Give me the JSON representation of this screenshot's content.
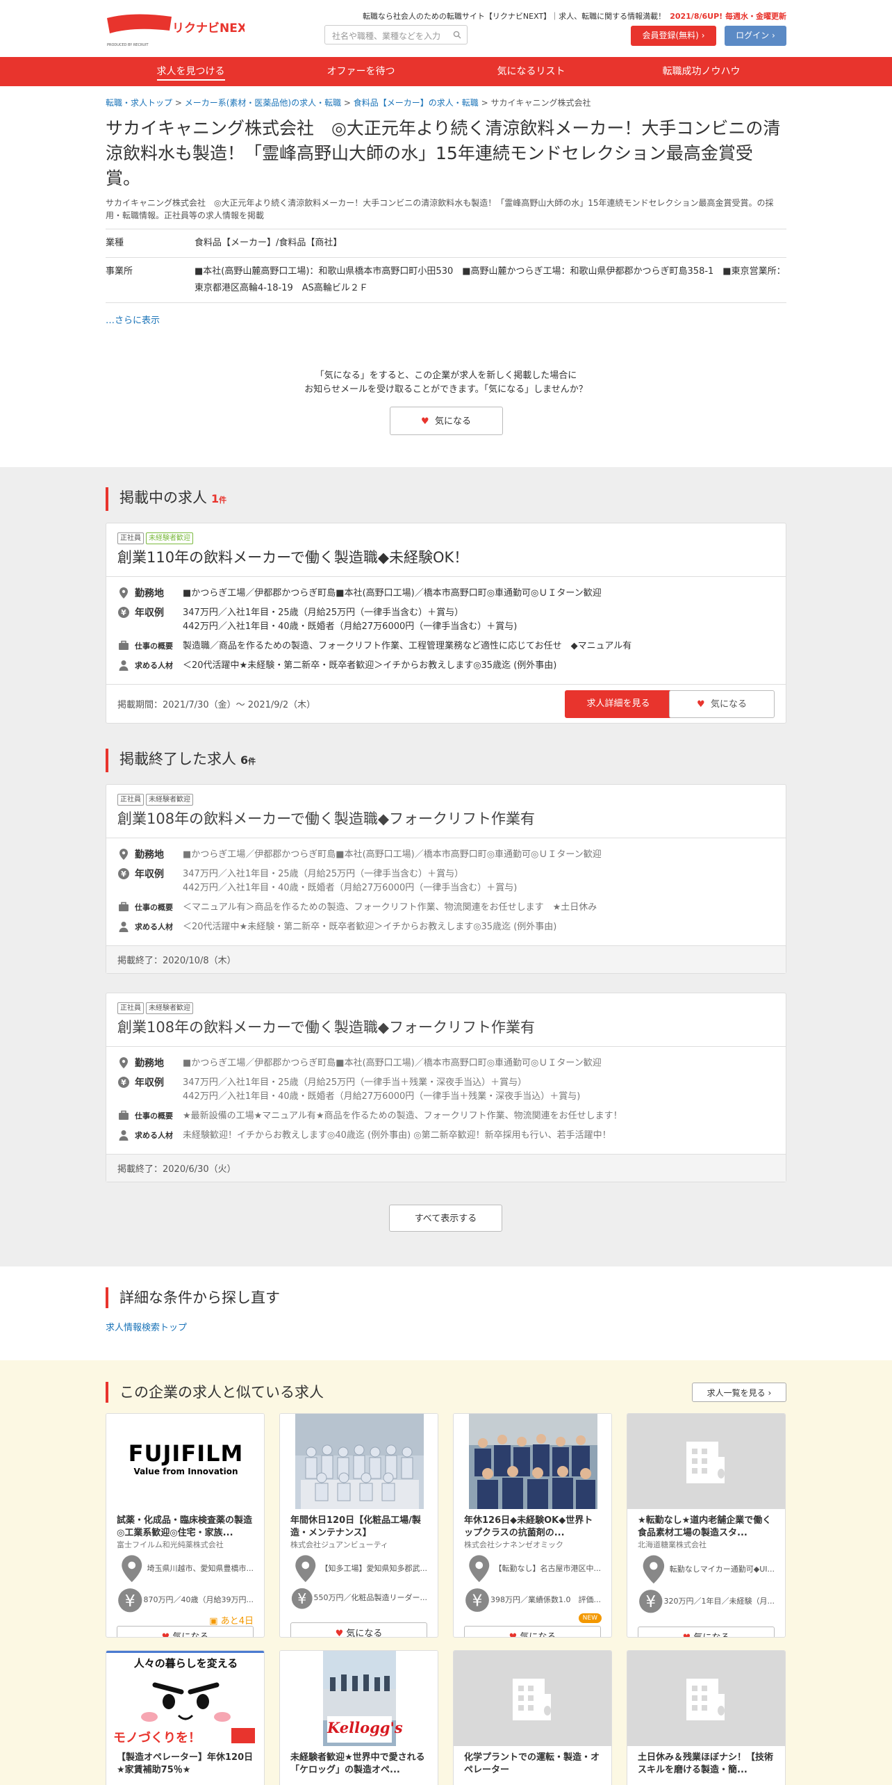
{
  "header": {
    "tagline": "転職なら社会人のための転職サイト【リクナビNEXT】｜求人、転職に関する情報満載！",
    "update_note": "2021/8/6UP! 毎週水・金曜更新",
    "logo_text": "リクナビNEXT",
    "logo_sub": "PRODUCED BY RECRUIT",
    "search_placeholder": "社名や職種、業種などを入力",
    "register_label": "会員登録(無料)",
    "login_label": "ログイン"
  },
  "nav": [
    "求人を見つける",
    "オファーを待つ",
    "気になるリスト",
    "転職成功ノウハウ"
  ],
  "breadcrumb": [
    "転職・求人トップ",
    "メーカー系(素材・医薬品他)の求人・転職",
    "食料品【メーカー】の求人・転職",
    "サカイキャニング株式会社"
  ],
  "company": {
    "title": "サカイキャニング株式会社　◎大正元年より続く清涼飲料メーカー！大手コンビニの清涼飲料水も製造！「霊峰高野山大師の水」15年連続モンドセレクション最高金賞受賞。",
    "description": "サカイキャニング株式会社　◎大正元年より続く清涼飲料メーカー！大手コンビニの清涼飲料水も製造！「霊峰高野山大師の水」15年連続モンドセレクション最高金賞受賞。の採用・転職情報。正社員等の求人情報を掲載",
    "info": [
      {
        "key": "業種",
        "value": "食料品【メーカー】/食料品【商社】"
      },
      {
        "key": "事業所",
        "value": "■本社(高野山麓高野口工場)：和歌山県橋本市高野口町小田530　■高野山麓かつらぎ工場：和歌山県伊都郡かつらぎ町島358-1　■東京営業所：東京都港区高輪4-18-19　AS高輪ビル２Ｆ"
      }
    ],
    "more_link": "…さらに表示"
  },
  "favorite_prompt": {
    "line1": "「気になる」をすると、この企業が求人を新しく掲載した場合に",
    "line2": "お知らせメールを受け取ることができます。「気になる」しませんか？",
    "button": "気になる"
  },
  "labels": {
    "location": "勤務地",
    "salary": "年収例",
    "summary": "仕事の概要",
    "wanted": "求める人材",
    "detail_button": "求人詳細を見る",
    "fav_button": "気になる",
    "count_unit": "件"
  },
  "open_jobs": {
    "heading": "掲載中の求人",
    "count": "1",
    "items": [
      {
        "tags": [
          "正社員",
          "未経験者歓迎"
        ],
        "title": "創業110年の飲料メーカーで働く製造職◆未経験OK！",
        "location": "■かつらぎ工場／伊都郡かつらぎ町島■本社(高野口工場)／橋本市高野口町◎車通勤可◎ＵＩターン歓迎",
        "salary1": "347万円／入社1年目・25歳（月給25万円（一律手当含む）＋賞与）",
        "salary2": "442万円／入社1年目・40歳・既婚者（月給27万6000円（一律手当含む）＋賞与)",
        "summary": "製造職／商品を作るための製造、フォークリフト作業、工程管理業務など適性に応じてお任せ　◆マニュアル有",
        "wanted": "＜20代活躍中★未経験・第二新卒・既卒者歓迎＞イチからお教えします◎35歳迄 (例外事由)",
        "period": "掲載期間：2021/7/30（金）～ 2021/9/2（木）"
      }
    ]
  },
  "closed_jobs": {
    "heading": "掲載終了した求人",
    "count": "6",
    "items": [
      {
        "tags": [
          "正社員",
          "未経験者歓迎"
        ],
        "title": "創業108年の飲料メーカーで働く製造職◆フォークリフト作業有",
        "location": "■かつらぎ工場／伊都郡かつらぎ町島■本社(高野口工場)／橋本市高野口町◎車通勤可◎ＵＩターン歓迎",
        "salary1": "347万円／入社1年目・25歳（月給25万円（一律手当含む）＋賞与）",
        "salary2": "442万円／入社1年目・40歳・既婚者（月給27万6000円（一律手当含む）＋賞与)",
        "summary": "＜マニュアル有＞商品を作るための製造、フォークリフト作業、物流関連をお任せします　★土日休み",
        "wanted": "＜20代活躍中★未経験・第二新卒・既卒者歓迎＞イチからお教えします◎35歳迄 (例外事由)",
        "ended": "掲載終了：2020/10/8（木）"
      },
      {
        "tags": [
          "正社員",
          "未経験者歓迎"
        ],
        "title": "創業108年の飲料メーカーで働く製造職◆フォークリフト作業有",
        "location": "■かつらぎ工場／伊都郡かつらぎ町島■本社(高野口工場)／橋本市高野口町◎車通勤可◎ＵＩターン歓迎",
        "salary1": "347万円／入社1年目・25歳（月給25万円（一律手当＋残業・深夜手当込）＋賞与）",
        "salary2": "442万円／入社1年目・40歳・既婚者（月給27万6000円（一律手当＋残業・深夜手当込）＋賞与)",
        "summary": "★最新設備の工場★マニュアル有★商品を作るための製造、フォークリフト作業、物流関連をお任せします！",
        "wanted": "未経験歓迎！イチからお教えします◎40歳迄 (例外事由) ◎第二新卒歓迎！新卒採用も行い、若手活躍中！",
        "ended": "掲載終了：2020/6/30（火）"
      }
    ],
    "show_all": "すべて表示する"
  },
  "search_again": {
    "heading": "詳細な条件から探し直す",
    "link": "求人情報検索トップ"
  },
  "similar": {
    "heading": "この企業の求人と似ている求人",
    "list_button": "求人一覧を見る",
    "cards": [
      {
        "image": "fujifilm-logo",
        "logo_text": "FUJIFILM",
        "logo_sub": "Value from Innovation",
        "title": "試薬・化成品・臨床検査薬の製造◎工業系歓迎◎住宅・家族...",
        "company": "富士フイルム和光純薬株式会社",
        "location": "埼玉県川越市、愛知県豊橋市...",
        "salary": "870万円／40歳（月給39万円...",
        "badge": "あと4日"
      },
      {
        "image": "staff-group-photo",
        "title": "年間休日120日【化粧品工場/製造・メンテナンス】",
        "company": "株式会社ジュアンビューティ",
        "location": "【知多工場】愛知県知多郡武...",
        "salary": "550万円／化粧品製造リーダー...",
        "badge": ""
      },
      {
        "image": "team-photo",
        "title": "年休126日◆未経験OK◆世界トップクラスの抗菌剤の...",
        "company": "株式会社シナネンゼオミック",
        "location": "【転勤なし】名古屋市港区中...",
        "salary": "398万円／業績係数1.0　評価...",
        "badge": "NEW"
      },
      {
        "image": "building-placeholder",
        "title": "★転勤なし★道内老舗企業で働く食品素材工場の製造スタ...",
        "company": "北海道糖業株式会社",
        "location": "転勤なしマイカー通勤可◆UI...",
        "salary": "320万円／1年目／未経験（月...",
        "badge": ""
      },
      {
        "image": "monozukuri-banner",
        "banner_line1": "人々の暮らしを変える",
        "banner_line2": "モノづくりを！",
        "title": "【製造オペレーター】年休120日★家賃補助75％★",
        "company": "",
        "location": "",
        "salary": "",
        "badge": ""
      },
      {
        "image": "kelloggs-photo",
        "logo_text": "Kellogg's",
        "title": "未経験者歓迎★世界中で愛される「ケロッグ」の製造オペ...",
        "company": "",
        "location": "",
        "salary": "",
        "badge": ""
      },
      {
        "image": "building-placeholder",
        "title": "化学プラントでの運転・製造・オペレーター",
        "company": "",
        "location": "",
        "salary": "",
        "badge": ""
      },
      {
        "image": "building-placeholder",
        "title": "土日休み＆残業ほぼナシ！【技術スキルを磨ける製造・簡...",
        "company": "",
        "location": "",
        "salary": "",
        "badge": ""
      }
    ]
  },
  "colors": {
    "brand_red": "#e8342d",
    "login_blue": "#5b8ac5",
    "link_blue": "#1a73b8",
    "new_orange": "#f39800",
    "gray_bg": "#eeeeee",
    "yellow_bg": "#fcf8e3"
  }
}
